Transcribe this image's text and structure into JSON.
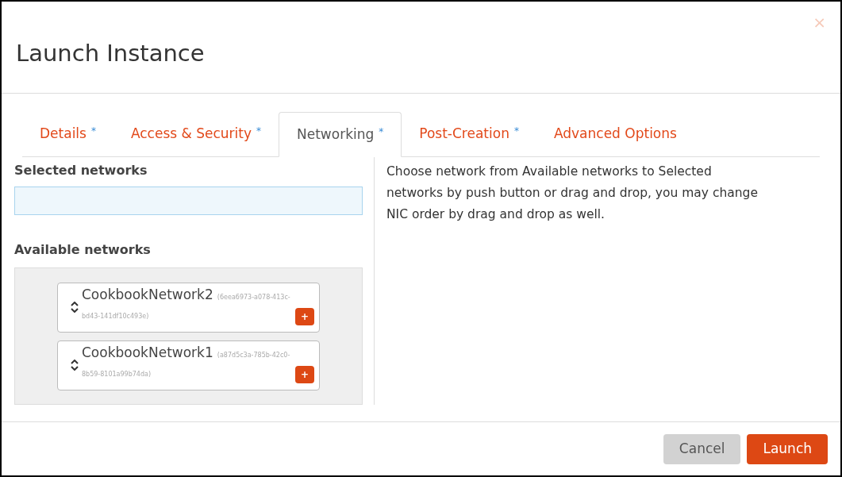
{
  "dialog": {
    "title": "Launch Instance",
    "close": "×"
  },
  "tabs": [
    {
      "label": "Details",
      "mark": "*",
      "selected": false
    },
    {
      "label": "Access & Security",
      "mark": "*",
      "selected": false
    },
    {
      "label": "Networking",
      "mark": "*",
      "selected": true
    },
    {
      "label": "Post-Creation",
      "mark": "*",
      "selected": false
    },
    {
      "label": "Advanced Options",
      "selected": false
    }
  ],
  "selected_networks": {
    "heading": "Selected networks"
  },
  "available_networks": {
    "heading": "Available networks",
    "items": [
      {
        "name": "CookbookNetwork2",
        "id": [
          "(6eea6973-a078-413c-",
          "bd43-141df10c493e)"
        ],
        "add": "+"
      },
      {
        "name": "CookbookNetwork1",
        "id": [
          "(a87d5c3a-785b-42c0-",
          "8b59-8101a99b74da)"
        ],
        "add": "+"
      }
    ]
  },
  "help": "Choose network from Available networks to Selected networks by push button or drag and drop, you may change NIC order by drag and drop as well.",
  "buttons": [
    {
      "label": "Cancel",
      "kind": "secondary"
    },
    {
      "label": "Launch",
      "kind": "primary"
    }
  ]
}
